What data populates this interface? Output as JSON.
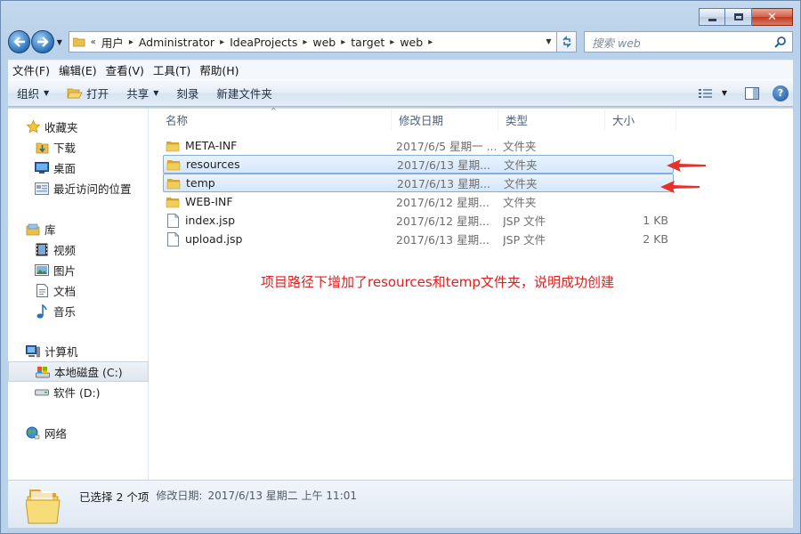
{
  "window": {
    "caption": {
      "minimize": "—",
      "maximize": "□",
      "close": "✕"
    }
  },
  "address_bar": {
    "overflow": "«",
    "crumbs": [
      "用户",
      "Administrator",
      "IdeaProjects",
      "web",
      "target",
      "web"
    ]
  },
  "search": {
    "placeholder": "搜索 web"
  },
  "menu": [
    "文件(F)",
    "编辑(E)",
    "查看(V)",
    "工具(T)",
    "帮助(H)"
  ],
  "toolbar": {
    "organize": "组织",
    "open": "打开",
    "share": "共享",
    "burn": "刻录",
    "new_folder": "新建文件夹"
  },
  "sidebar": {
    "favorites": {
      "label": "收藏夹",
      "items": [
        "下载",
        "桌面",
        "最近访问的位置"
      ]
    },
    "libraries": {
      "label": "库",
      "items": [
        "视频",
        "图片",
        "文档",
        "音乐"
      ]
    },
    "computer": {
      "label": "计算机",
      "items": [
        "本地磁盘 (C:)",
        "软件 (D:)"
      ]
    },
    "network": {
      "label": "网络"
    }
  },
  "columns": {
    "name": "名称",
    "date": "修改日期",
    "type": "类型",
    "size": "大小"
  },
  "files": [
    {
      "name": "META-INF",
      "date": "2017/6/5 星期一 ...",
      "type": "文件夹",
      "size": "",
      "icon": "folder-icon",
      "selected": false
    },
    {
      "name": "resources",
      "date": "2017/6/13 星期...",
      "type": "文件夹",
      "size": "",
      "icon": "folder-icon",
      "selected": true
    },
    {
      "name": "temp",
      "date": "2017/6/13 星期...",
      "type": "文件夹",
      "size": "",
      "icon": "folder-icon",
      "selected": true
    },
    {
      "name": "WEB-INF",
      "date": "2017/6/12 星期...",
      "type": "文件夹",
      "size": "",
      "icon": "folder-icon",
      "selected": false
    },
    {
      "name": "index.jsp",
      "date": "2017/6/12 星期...",
      "type": "JSP 文件",
      "size": "1 KB",
      "icon": "file-icon",
      "selected": false
    },
    {
      "name": "upload.jsp",
      "date": "2017/6/13 星期...",
      "type": "JSP 文件",
      "size": "2 KB",
      "icon": "file-icon",
      "selected": false
    }
  ],
  "annotation": "项目路径下增加了resources和temp文件夹，说明成功创建",
  "details": {
    "selection": "已选择 2 个项",
    "modified_label": "修改日期:",
    "modified_value": "2017/6/13 星期二 上午 11:01"
  },
  "colors": {
    "annotation": "#e02020",
    "arrow": "#e8302a",
    "selection_border": "#84acdd"
  }
}
